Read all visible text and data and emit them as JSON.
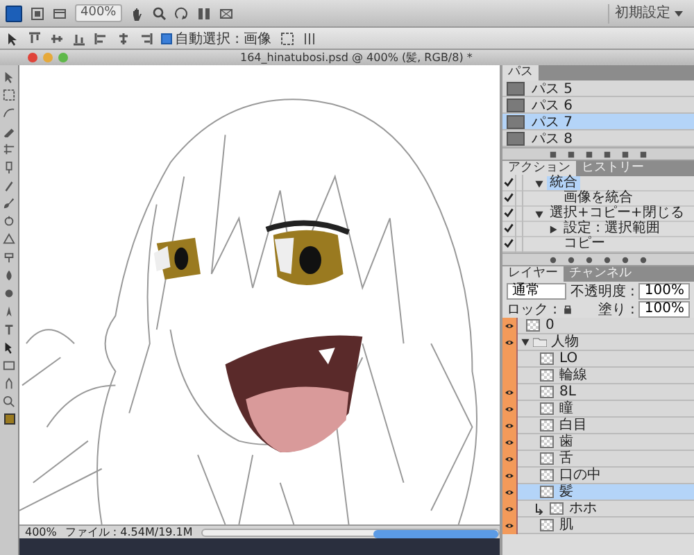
{
  "app_bar": {
    "zoom": "400%",
    "workspace": "初期設定"
  },
  "options_bar": {
    "auto_select": {
      "label": "自動選択 : 画像",
      "checked": true
    }
  },
  "document": {
    "title": "164_hinatubosi.psd @ 400% (髪, RGB/8) *"
  },
  "status_bar": {
    "zoom": "400%",
    "file_info": "ファイル : 4.54M/19.1M"
  },
  "paths_panel": {
    "tabs": [
      {
        "label": "パス",
        "selected": true
      }
    ],
    "items": [
      {
        "name": "パス 5",
        "selected": false
      },
      {
        "name": "パス 6",
        "selected": false
      },
      {
        "name": "パス 7",
        "selected": true
      },
      {
        "name": "パス 8",
        "selected": false
      }
    ]
  },
  "actions_panel": {
    "tabs": [
      {
        "label": "アクション",
        "selected": true
      },
      {
        "label": "ヒストリー",
        "selected": false
      }
    ],
    "items": [
      {
        "name": "統合",
        "checked": true,
        "expanded": true,
        "selected": true,
        "children": [
          {
            "name": "画像を統合",
            "checked": true,
            "selected": false
          }
        ]
      },
      {
        "name": "選択+コピー+閉じる",
        "checked": true,
        "expanded": true,
        "selected": false,
        "children": [
          {
            "name": "設定 : 選択範囲",
            "checked": true,
            "expanded": false,
            "selected": false
          },
          {
            "name": "コピー",
            "checked": true,
            "selected": false
          }
        ]
      }
    ]
  },
  "layers_panel": {
    "tabs": [
      {
        "label": "レイヤー",
        "selected": true
      },
      {
        "label": "チャンネル",
        "selected": false
      }
    ],
    "blend_mode": "通常",
    "opacity_label": "不透明度 :",
    "opacity": "100%",
    "lock_label": "ロック :",
    "fill_label": "塗り :",
    "fill": "100%",
    "layers": [
      {
        "kind": "layer",
        "name": "0",
        "visible": true,
        "selected": false
      },
      {
        "kind": "group",
        "name": "人物",
        "visible": true,
        "selected": false,
        "expanded": true,
        "children": [
          {
            "kind": "layer",
            "name": "LO",
            "visible": false,
            "selected": false
          },
          {
            "kind": "layer",
            "name": "輪線",
            "visible": false,
            "selected": false
          },
          {
            "kind": "layer",
            "name": "8L",
            "visible": true,
            "selected": false
          },
          {
            "kind": "layer",
            "name": "瞳",
            "visible": true,
            "selected": false
          },
          {
            "kind": "layer",
            "name": "白目",
            "visible": true,
            "selected": false
          },
          {
            "kind": "layer",
            "name": "歯",
            "visible": true,
            "selected": false
          },
          {
            "kind": "layer",
            "name": "舌",
            "visible": true,
            "selected": false
          },
          {
            "kind": "layer",
            "name": "口の中",
            "visible": true,
            "selected": false
          },
          {
            "kind": "layer",
            "name": "髪",
            "visible": true,
            "selected": true
          },
          {
            "kind": "clipped",
            "name": "ホホ",
            "visible": true,
            "selected": false
          },
          {
            "kind": "layer",
            "name": "肌",
            "visible": true,
            "selected": false
          }
        ]
      }
    ]
  }
}
